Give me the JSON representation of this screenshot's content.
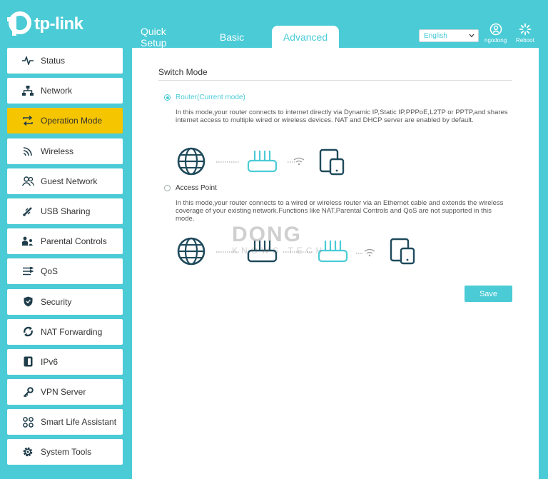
{
  "brand": {
    "logo_text": "tp-link"
  },
  "tabs": [
    {
      "label": "Quick Setup"
    },
    {
      "label": "Basic"
    },
    {
      "label": "Advanced"
    }
  ],
  "header": {
    "language": "English",
    "user_label": "ngodong",
    "reboot_label": "Reboot"
  },
  "sidebar": {
    "items": [
      {
        "label": "Status",
        "icon": "pulse-icon"
      },
      {
        "label": "Network",
        "icon": "network-icon"
      },
      {
        "label": "Operation Mode",
        "icon": "switch-arrows-icon"
      },
      {
        "label": "Wireless",
        "icon": "wifi-icon"
      },
      {
        "label": "Guest Network",
        "icon": "guest-icon"
      },
      {
        "label": "USB Sharing",
        "icon": "usb-icon"
      },
      {
        "label": "Parental Controls",
        "icon": "family-icon"
      },
      {
        "label": "QoS",
        "icon": "qos-icon"
      },
      {
        "label": "Security",
        "icon": "shield-icon"
      },
      {
        "label": "NAT Forwarding",
        "icon": "nat-icon"
      },
      {
        "label": "IPv6",
        "icon": "ipv6-icon"
      },
      {
        "label": "VPN Server",
        "icon": "key-icon"
      },
      {
        "label": "Smart Life Assistant",
        "icon": "grid-icon"
      },
      {
        "label": "System Tools",
        "icon": "gear-icon"
      }
    ],
    "active": "Operation Mode"
  },
  "main": {
    "section_title": "Switch Mode",
    "router_mode": {
      "label": "Router(Current mode)",
      "selected": true,
      "description": "In this mode,your router connects to internet directly via Dynamic IP,Static IP,PPPoE,L2TP or PPTP,and shares internet access to multiple wired or wireless devices. NAT and DHCP server are enabled by default."
    },
    "ap_mode": {
      "label": "Access Point",
      "selected": false,
      "description": "In this mode,your router connects to a wired or wireless router via an Ethernet cable and extends the wireless coverage of your existing network.Functions like NAT,Parental Controls and QoS are not supported in this mode."
    },
    "save_label": "Save"
  },
  "watermark": {
    "line1": "DONG",
    "line2": "KNOWS TECH"
  },
  "colors": {
    "accent": "#4acbd6",
    "active_nav": "#f5c500",
    "icon_dark": "#1f4a5c"
  }
}
